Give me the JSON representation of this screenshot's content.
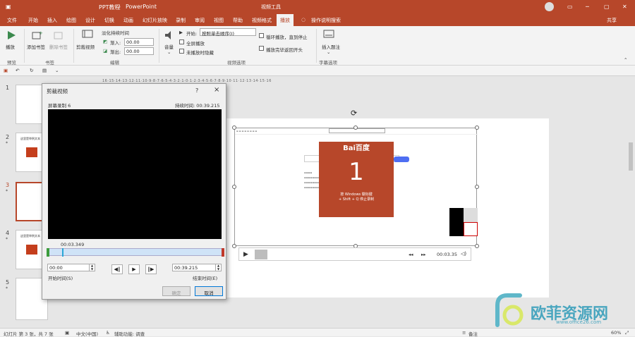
{
  "titlebar": {
    "doc_title": "PPT教程",
    "app": "PowerPoint",
    "context_tab": "视频工具",
    "share": "共享"
  },
  "tabs": [
    "文件",
    "开始",
    "插入",
    "绘图",
    "设计",
    "切换",
    "动画",
    "幻灯片放映",
    "录制",
    "审阅",
    "视图",
    "帮助",
    "视频格式",
    "播放"
  ],
  "search": "操作说明搜索",
  "ribbon": {
    "play": "播放",
    "add_bookmark": "添加书签",
    "remove_bookmark": "删除书签",
    "trim": "剪裁视频",
    "fade_duration": "淡化持续时间",
    "fade_in": "渐入:",
    "fade_in_value": "00.00",
    "fade_out": "渐出:",
    "fade_out_value": "00.00",
    "volume": "音量",
    "start": "开始:",
    "start_value": "按照单击顺序(I)",
    "fullscreen": "全屏播放",
    "hide": "未播放时隐藏",
    "loop": "循环播放，直到停止",
    "rewind": "播放完毕返回开头",
    "insert_caption": "插入题注",
    "groups": {
      "preview": "预览",
      "bookmarks": "书签",
      "edit": "编辑",
      "video_options": "视频选项",
      "caption_options": "字幕选项"
    }
  },
  "ruler": "16·15·14·13·12·11·10·9·8·7·6·5·4·3·2·1·0·1·2·3·4·5·6·7·8·9·10·11·12·13·14·15·16",
  "slides": [
    {
      "num": "1"
    },
    {
      "num": "2",
      "caption": "这里是举例文本"
    },
    {
      "num": "3"
    },
    {
      "num": "4",
      "caption": "这里是举例文本"
    },
    {
      "num": "5"
    }
  ],
  "dialog": {
    "title": "剪裁视频",
    "help": "?",
    "close": "×",
    "video_name": "屏幕录制 6",
    "duration": "持续时间: 00:39.215",
    "current_time": "00:03.349",
    "start_time_value": "00:00",
    "end_time_value": "00:39.215",
    "start_time_label": "开始时间(S)",
    "end_time_label": "结束时间(E)",
    "ok": "确定",
    "cancel": "取消"
  },
  "video": {
    "baidu": "Bai百度",
    "countdown": "1",
    "hint1": "按 Windows 徽标键",
    "hint2": "+ Shift + Q 停止录制",
    "time": "00:03.35"
  },
  "status": {
    "slide": "幻灯片 第 3 张，共 7 张",
    "lang": "中文(中国)",
    "access": "辅助功能: 调查",
    "notes": "备注",
    "zoom": "60%"
  },
  "watermark": {
    "cn": "欧菲资源网",
    "url": "www.office26.com"
  },
  "colors": {
    "accent": "#b7472a"
  }
}
